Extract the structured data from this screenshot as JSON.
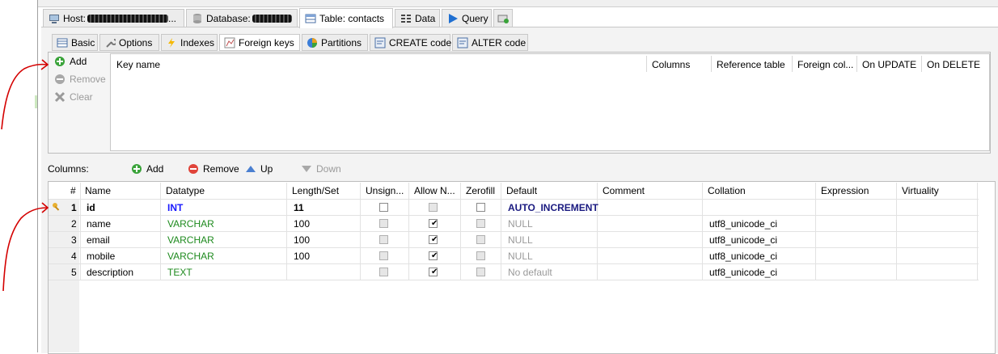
{
  "main_tabs": [
    {
      "label": "Host: ",
      "redacted": true
    },
    {
      "label": "Database: ",
      "redacted": true
    },
    {
      "label": "Table: contacts"
    },
    {
      "label": "Data"
    },
    {
      "label": "Query"
    }
  ],
  "sub_tabs": [
    "Basic",
    "Options",
    "Indexes",
    "Foreign keys",
    "Partitions",
    "CREATE code",
    "ALTER code"
  ],
  "fk_panel": {
    "add": "Add",
    "remove": "Remove",
    "clear": "Clear",
    "headers": [
      "Key name",
      "Columns",
      "Reference table",
      "Foreign col...",
      "On UPDATE",
      "On DELETE"
    ]
  },
  "columns_toolbar": {
    "label": "Columns:",
    "add": "Add",
    "remove": "Remove",
    "up": "Up",
    "down": "Down"
  },
  "grid": {
    "headers": [
      "#",
      "Name",
      "Datatype",
      "Length/Set",
      "Unsign...",
      "Allow N...",
      "Zerofill",
      "Default",
      "Comment",
      "Collation",
      "Expression",
      "Virtuality"
    ],
    "rows": [
      {
        "num": "1",
        "name": "id",
        "datatype": "INT",
        "length": "11",
        "unsigned": false,
        "allow_null": false,
        "zerofill": false,
        "default": "AUTO_INCREMENT",
        "comment": "",
        "collation": "",
        "primary_key": true
      },
      {
        "num": "2",
        "name": "name",
        "datatype": "VARCHAR",
        "length": "100",
        "unsigned": false,
        "allow_null": true,
        "zerofill": false,
        "default": "NULL",
        "comment": "",
        "collation": "utf8_unicode_ci"
      },
      {
        "num": "3",
        "name": "email",
        "datatype": "VARCHAR",
        "length": "100",
        "unsigned": false,
        "allow_null": true,
        "zerofill": false,
        "default": "NULL",
        "comment": "",
        "collation": "utf8_unicode_ci"
      },
      {
        "num": "4",
        "name": "mobile",
        "datatype": "VARCHAR",
        "length": "100",
        "unsigned": false,
        "allow_null": true,
        "zerofill": false,
        "default": "NULL",
        "comment": "",
        "collation": "utf8_unicode_ci"
      },
      {
        "num": "5",
        "name": "description",
        "datatype": "TEXT",
        "length": "",
        "unsigned": false,
        "allow_null": true,
        "zerofill": false,
        "default": "No default",
        "comment": "",
        "collation": "utf8_unicode_ci"
      }
    ]
  },
  "colors": {
    "int_type": "#1a1aff",
    "string_type": "#1e8a1e",
    "annotation_red": "#d40000"
  }
}
